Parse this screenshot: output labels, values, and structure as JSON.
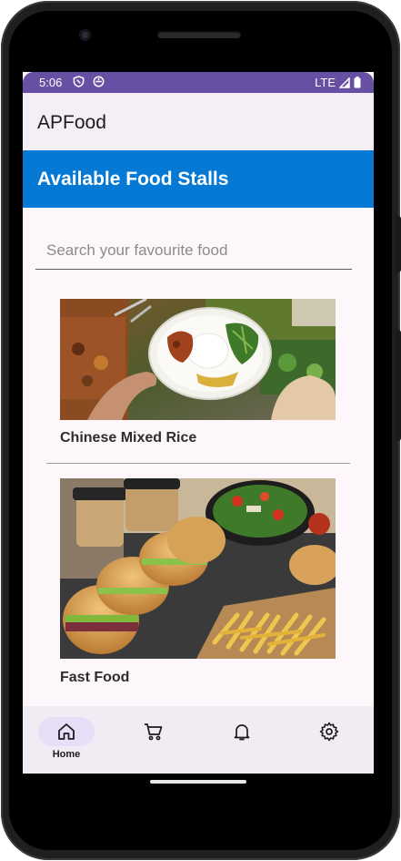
{
  "status_bar": {
    "time": "5:06",
    "network": "LTE"
  },
  "app_bar": {
    "title": "APFood"
  },
  "banner": {
    "title": "Available Food Stalls"
  },
  "search": {
    "placeholder": "Search your favourite food"
  },
  "stalls": [
    {
      "name": "Chinese Mixed Rice",
      "image": "plate of mixed rice with dishes"
    },
    {
      "name": "Fast Food",
      "image": "burgers, fries, salad and coffee"
    }
  ],
  "bottom_nav": {
    "items": [
      {
        "label": "Home",
        "icon": "home-icon",
        "active": true
      },
      {
        "label": "",
        "icon": "cart-icon",
        "active": false
      },
      {
        "label": "",
        "icon": "bell-icon",
        "active": false
      },
      {
        "label": "",
        "icon": "gear-icon",
        "active": false
      }
    ]
  },
  "colors": {
    "status_bar": "#6750a4",
    "banner": "#0579d4",
    "nav_active": "#e8def8",
    "background": "#fdf7fc"
  }
}
